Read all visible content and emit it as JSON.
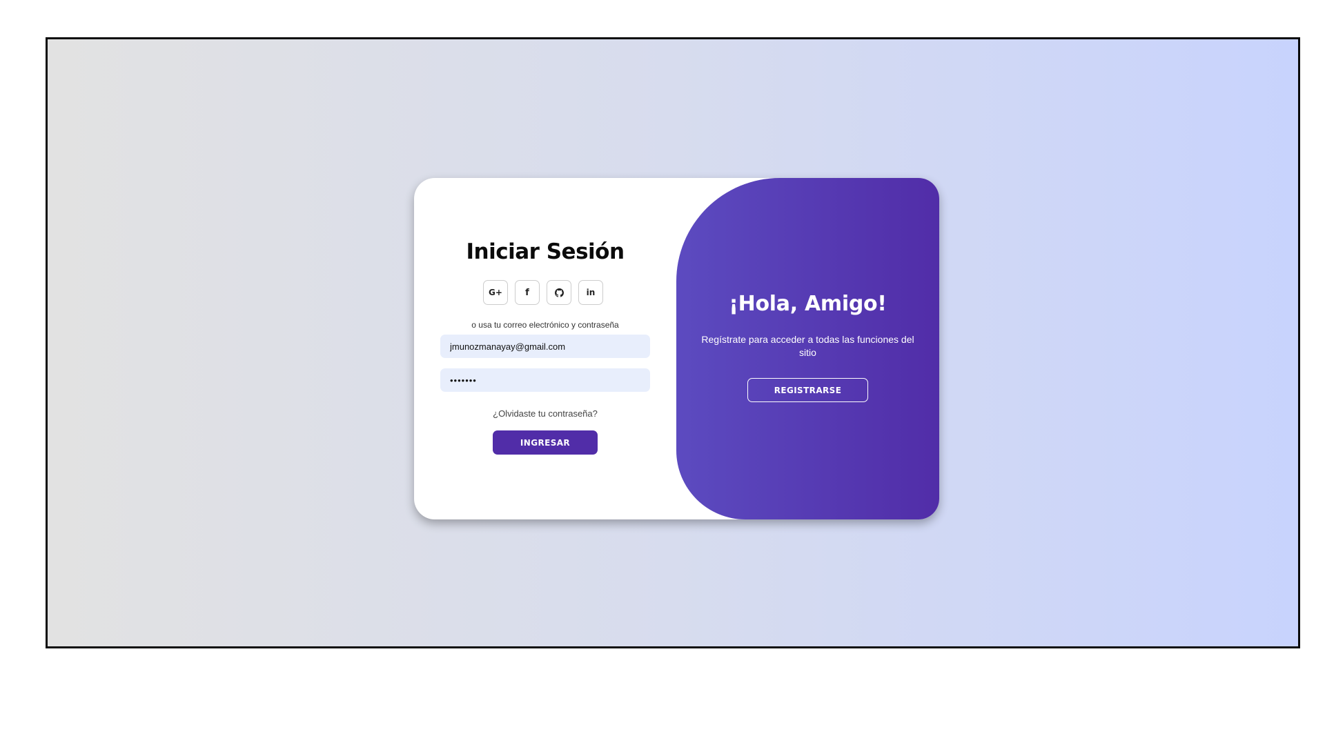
{
  "signin": {
    "title": "Iniciar Sesión",
    "social": [
      {
        "label": "G+",
        "icon": "google-plus-icon"
      },
      {
        "label": "f",
        "icon": "facebook-icon"
      },
      {
        "label": "",
        "icon": "github-icon"
      },
      {
        "label": "in",
        "icon": "linkedin-icon"
      }
    ],
    "divider_text": "o usa tu correo electrónico y contraseña",
    "email_value": "jmunozmanayay@gmail.com",
    "password_value": "•••••••",
    "forgot_label": "¿Olvidaste tu contraseña?",
    "submit_label": "INGRESAR"
  },
  "panel": {
    "title": "¡Hola, Amigo!",
    "text": "Regístrate para acceder a todas las funciones del sitio",
    "register_label": "REGISTRARSE"
  },
  "colors": {
    "primary": "#512da8",
    "field_bg": "#e8eefc"
  }
}
